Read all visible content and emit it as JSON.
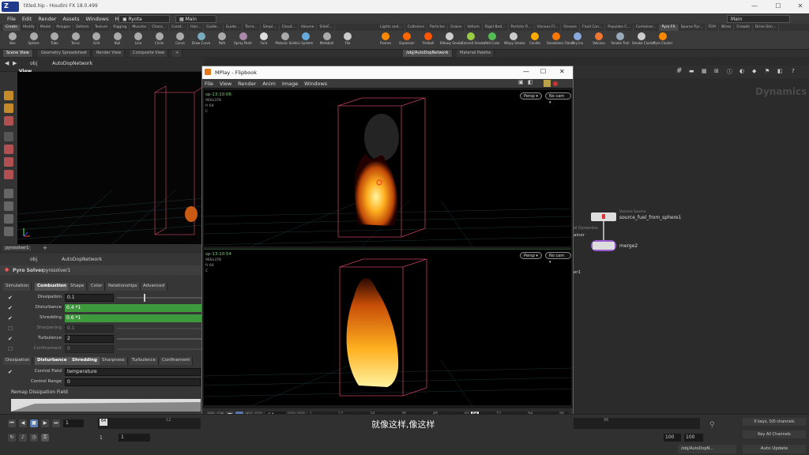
{
  "window": {
    "title": "titled.hip - Houdini FX 18.0.499",
    "logo_text": "Z",
    "minimize": "—",
    "maximize": "☐",
    "close": "✕"
  },
  "menubar": {
    "items": [
      "File",
      "Edit",
      "Render",
      "Assets",
      "Windows",
      "Help"
    ],
    "desktop": "Ryota",
    "layout": "Main",
    "right_layout": "Main"
  },
  "shelf_tabs_left": [
    "Create",
    "Modify",
    "Model",
    "Polygon",
    "Deform",
    "Texture",
    "Rigging",
    "Muscles",
    "Chara...",
    "Const...",
    "Hair...",
    "Guide...",
    "Guide...",
    "Terra...",
    "Simpl...",
    "Cloud...",
    "Volume",
    "SideF..."
  ],
  "shelf_tabs_right": [
    "Lights and...",
    "Collisions",
    "Particles",
    "Grains",
    "Vellum",
    "Rigid Bod...",
    "Particle Fl...",
    "Viscous Fl...",
    "Oceans",
    "Fluid Con...",
    "Populate C...",
    "Container...",
    "Pyro FX",
    "Sparse Pyr...",
    "FEM",
    "Wires",
    "Crowds",
    "Drive Sim..."
  ],
  "shelf_tools_left": [
    "Box",
    "Sphere",
    "Tube",
    "Torus",
    "Grid",
    "Null",
    "Line",
    "Circle",
    "Curve",
    "Draw Curve",
    "Path",
    "Spray Paint",
    "Font",
    "Platonic Solids",
    "L-System",
    "Metaball",
    "File"
  ],
  "shelf_tools_right": [
    "Flames",
    "Explosion",
    "Fireball",
    "Billowy Smoke",
    "Colored Smoke",
    "Add Color",
    "Wispy Smoke",
    "Candle",
    "Smokeless Flame",
    "Dry Ice",
    "Volcano",
    "Smoke Trail",
    "Smoke Cluster",
    "Pyro Cluster"
  ],
  "pane_tabs": {
    "left": [
      "Scene View",
      "Geometry Spreadsheet",
      "Render View",
      "Composite View"
    ],
    "right": [
      "/obj/AutoDopNetwork",
      "Material Palette"
    ]
  },
  "path": {
    "context": "obj",
    "node": "AutoDopNetwork"
  },
  "viewport_label": "View",
  "params": {
    "tab_name": "pyrosolver1",
    "node_type": "Pyro Solver",
    "node_name": "pyrosolver1",
    "tabs": [
      "Simulation",
      "Combustion",
      "Shape",
      "Color",
      "Relationships",
      "Advanced"
    ],
    "rows": [
      {
        "label": "Dissipation",
        "value": "0.1"
      },
      {
        "label": "Disturbance",
        "value": "0.4 *1"
      },
      {
        "label": "Shredding",
        "value": "0.6 *1"
      },
      {
        "label": "Sharpening",
        "value": "0.1"
      },
      {
        "label": "Turbulence",
        "value": "2"
      },
      {
        "label": "Confinement",
        "value": "0"
      }
    ],
    "subtabs": [
      "Dissipation",
      "Disturbance",
      "Shredding",
      "Sharpness",
      "Turbulence",
      "Confinement"
    ],
    "control_field_label": "Control Field",
    "control_field_value": "temperature",
    "control_range_label": "Control Range",
    "control_range_value": "0",
    "remap_label": "Remap Dissipation Field"
  },
  "flipbook": {
    "title": "MPlay - Flipbook",
    "menu": [
      "File",
      "View",
      "Render",
      "Anim",
      "Image",
      "Windows"
    ],
    "view1": {
      "name": "sp-13:10:06",
      "res": "960x378",
      "fr": "fr 64",
      "c": "C"
    },
    "view2": {
      "name": "sp-13:10:54",
      "res": "960x378",
      "fr": "fr 64",
      "c": "C"
    },
    "persp": "Persp ▾",
    "nocam": "No cam ▾",
    "frame": "64",
    "start": "1",
    "end": "100",
    "fps": "24",
    "ticks": [
      "1",
      "12",
      "24",
      "36",
      "48",
      "60",
      "72",
      "84",
      "96"
    ]
  },
  "network": {
    "label": "Dynamics",
    "node1_type": "Volume Source",
    "node1_name": "source_fuel_from_sphere1",
    "node2_name": "merge2",
    "partial_left1": "ol Dynamics",
    "partial_left2": "ainer",
    "partial_left3": "er1"
  },
  "timeline": {
    "frame": "1",
    "start": "1",
    "end": "1",
    "current": "64",
    "range_end": "100",
    "range_end2": "100",
    "ticks": [
      "12",
      "24",
      "36",
      "48",
      "60",
      "72",
      "84",
      "96"
    ],
    "keys": "0 keys, 0/0 channels",
    "key_all": "Key All Channels",
    "update_path": "/obj/AutoDopN...",
    "auto_update": "Auto Update"
  },
  "subtitle": "就像这样,像这样",
  "colors": {
    "green": "#3c9a3c",
    "box": "#c0405a",
    "flame": "#ffb020"
  }
}
